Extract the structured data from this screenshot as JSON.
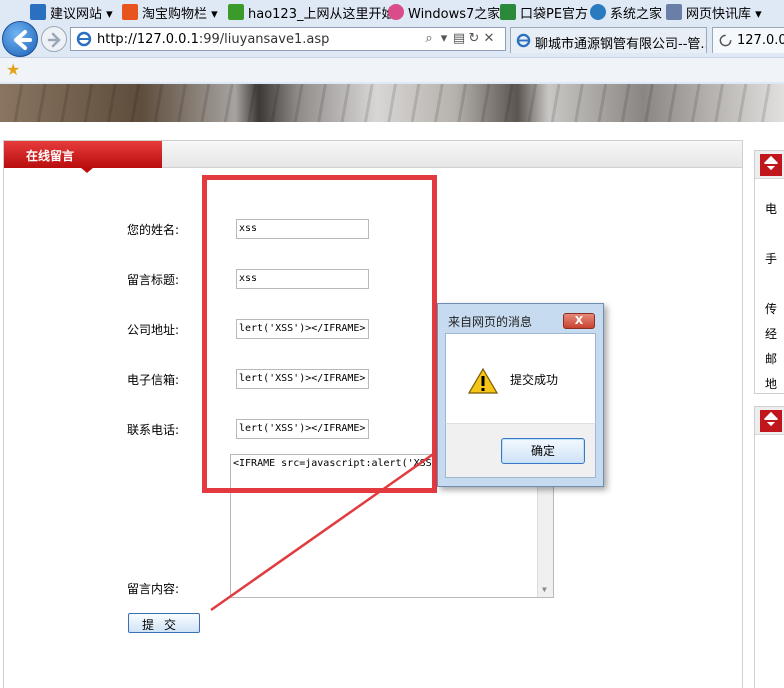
{
  "browser": {
    "url_prefix": "http://127.0.0.1",
    "url_rest": ":99/liuyansave1.asp",
    "tabs": [
      {
        "label": "聊城市通源钢管有限公司--管..."
      },
      {
        "label": "127.0.0.1"
      }
    ],
    "tool_icons": [
      "search-icon",
      "dropdown-icon",
      "compat-icon",
      "refresh-icon",
      "stop-icon"
    ]
  },
  "favorites": [
    {
      "label": "建议网站 ▾",
      "icon": "ie-page-icon",
      "color": "#2a6fc0"
    },
    {
      "label": "淘宝购物栏 ▾",
      "icon": "taobao-icon",
      "color": "#e8541e"
    },
    {
      "label": "hao123_上网从这里开始",
      "icon": "hao123-icon",
      "color": "#3a9a2a"
    },
    {
      "label": "Windows7之家",
      "icon": "win7-icon",
      "color": "#d94b8a"
    },
    {
      "label": "口袋PE官方",
      "icon": "pe-icon",
      "color": "#2a8a3a"
    },
    {
      "label": "系统之家",
      "icon": "system-home-icon",
      "color": "#2a7ac0"
    },
    {
      "label": "网页快讯库 ▾",
      "icon": "webslice-icon",
      "color": "#6a7fa8"
    }
  ],
  "form": {
    "section_title": "在线留言",
    "fields": [
      {
        "label": "您的姓名:",
        "value": "xss"
      },
      {
        "label": "留言标题:",
        "value": "xss"
      },
      {
        "label": "公司地址:",
        "value": "lert('XSS')></IFRAME>"
      },
      {
        "label": "电子信箱:",
        "value": "lert('XSS')></IFRAME>"
      },
      {
        "label": "联系电话:",
        "value": "lert('XSS')></IFRAME>"
      }
    ],
    "content_label": "留言内容:",
    "content_value": "<IFRAME src=javascript:alert('XSS')></IFRAME>",
    "submit_label": "提交"
  },
  "sidebar": {
    "lines": [
      "电",
      "手",
      "传",
      "经",
      "邮",
      "地"
    ]
  },
  "dialog": {
    "title": "来自网页的消息",
    "close_label": "X",
    "message": "提交成功",
    "ok_label": "确定"
  },
  "colors": {
    "highlight": "#e23a3f",
    "section_red": "#c0161c",
    "chrome_bg": "#dfe9f5"
  }
}
